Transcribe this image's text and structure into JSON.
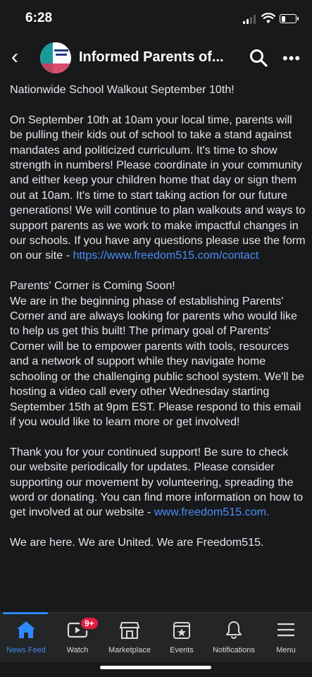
{
  "status": {
    "time": "6:28"
  },
  "header": {
    "title": "Informed Parents of..."
  },
  "post": {
    "p1": "Nationwide School Walkout September 10th!",
    "p2": "On September 10th at 10am your local time, parents will be pulling their kids out of school to take a stand against mandates and politicized curriculum. It's time to show strength in numbers! Please coordinate in your community and either keep your children home that day or sign them out at 10am. It's time to start taking action for our future generations! We will continue to plan walkouts and ways to support parents as we work to make impactful changes in our schools. If you have any questions please use the form on our site - ",
    "link1": "https://www.freedom515.com/contact",
    "p3": "Parents' Corner is Coming Soon!\nWe are in the beginning phase of establishing Parents' Corner and are always looking for parents who would like to help us get this built! The primary goal of Parents' Corner will be to empower parents with tools, resources and a network of support while they navigate home schooling or the challenging public school system. We'll be hosting a video call every other Wednesday starting September 15th at 9pm EST. Please respond to this email if you would like to learn more or get involved!",
    "p4": "Thank you for your continued support! Be sure to check our website periodically for updates. Please consider supporting our movement by volunteering, spreading the word or donating. You can find more information on how to get involved at our website - ",
    "link2": "www.freedom515.com.",
    "p5": "We are here. We are United. We are Freedom515."
  },
  "tabs": [
    {
      "label": "News Feed",
      "icon": "home-icon",
      "active": true
    },
    {
      "label": "Watch",
      "icon": "video-icon",
      "badge": "9+"
    },
    {
      "label": "Marketplace",
      "icon": "shop-icon"
    },
    {
      "label": "Events",
      "icon": "calendar-icon"
    },
    {
      "label": "Notifications",
      "icon": "bell-icon"
    },
    {
      "label": "Menu",
      "icon": "menu-icon"
    }
  ],
  "colors": {
    "background": "#18191a",
    "link": "#4a8df8",
    "accent": "#2d88ff",
    "badge": "#e41e3f"
  }
}
